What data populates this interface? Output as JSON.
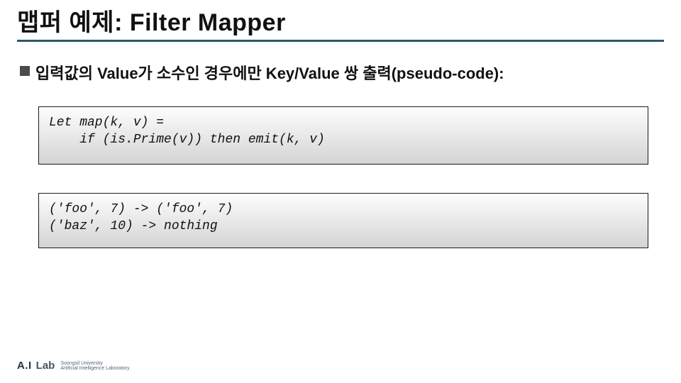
{
  "title": "맵퍼 예제: Filter Mapper",
  "bullet": "입력값의 Value가 소수인 경우에만 Key/Value 쌍 출력(pseudo-code):",
  "codebox1": "Let map(k, v) =\n    if (is.Prime(v)) then emit(k, v)",
  "codebox2": "('foo', 7) -> ('foo', 7)\n('baz', 10) -> nothing",
  "footer": {
    "brand_a": "A.I",
    "brand_b": "Lab",
    "sub1": "Soongsil University",
    "sub2": "Artificial Intelligence Laboratory"
  }
}
